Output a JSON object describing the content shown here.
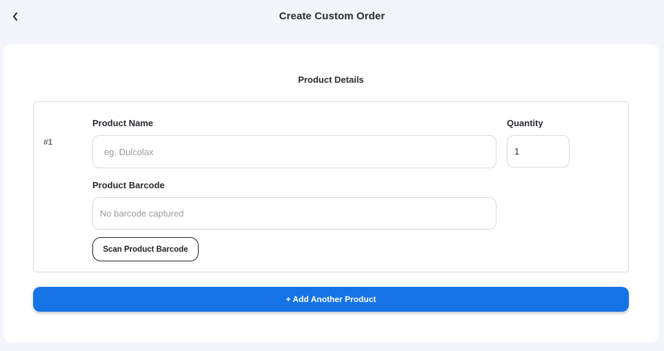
{
  "header": {
    "title": "Create Custom Order",
    "back_icon": "chevron-left-icon"
  },
  "section": {
    "title": "Product Details"
  },
  "product": {
    "index": "#1",
    "name_label": "Product Name",
    "name_value": "",
    "name_placeholder": "eg. Dulcolax",
    "quantity_label": "Quantity",
    "quantity_value": "1",
    "barcode_label": "Product Barcode",
    "barcode_value": "",
    "barcode_placeholder": "No barcode captured",
    "scan_button_label": "Scan Product Barcode"
  },
  "actions": {
    "add_product_label": "+ Add Another Product"
  },
  "colors": {
    "accent": "#1573e6",
    "background": "#f4f5fb",
    "card": "#ffffff",
    "border": "#d8d9de"
  }
}
